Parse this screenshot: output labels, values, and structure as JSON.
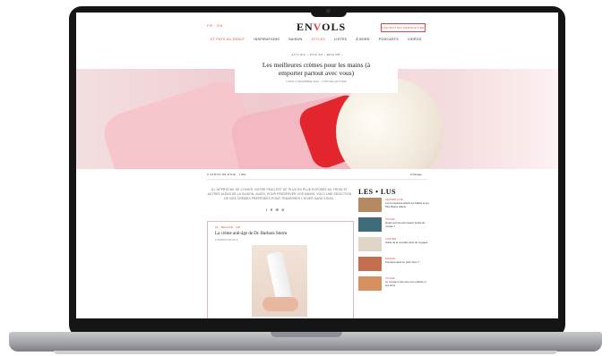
{
  "site": {
    "logo": "ENVOLS",
    "logo_accent_index": 2,
    "languages": "FR · EN",
    "newsletter_label": "INSCRIPTION NEWSLETTER"
  },
  "nav": {
    "items": [
      {
        "label": "ET PAYS AU DEBUT",
        "highlight": true
      },
      {
        "label": "INSPIRATIONS",
        "highlight": false
      },
      {
        "label": "SAISON",
        "highlight": false
      },
      {
        "label": "STYLES",
        "highlight": true
      },
      {
        "label": "LISTES",
        "highlight": false
      },
      {
        "label": "À BORD",
        "highlight": false
      },
      {
        "label": "PODCASTS",
        "highlight": false
      },
      {
        "label": "VIDÉOS",
        "highlight": false
      }
    ]
  },
  "breadcrumb": "ACCUEIL › STYLES › BEAUTÉ ›",
  "article": {
    "title_line1": "Les meilleures crèmes pour les mains (à",
    "title_line2": "emporter partout avec vous)",
    "meta": "LUNDI 2 DÉCEMBRE 2024 · 4 MIN DE LECTURE",
    "author": "À PARTIR DE ETHE · LIRE",
    "comments": "0 Partage",
    "intro": "À L'APPROCHE DE L'HIVER, NOTRE PEAU EST DE PLUS EN PLUS EXPOSÉE AU FROID ET AUTRES ALÉAS DE LA SAISON. AUSSI, POUR PRÉSERVER VOS MAINS, VOICI UNE SÉLECTION DE NOS CRÈMES PRÉFÉRÉES POUR TRAVERSER L'HIVER SANS SOUCI.",
    "share": "f ✕ ✉ ⊘"
  },
  "product_card": {
    "tag": "01 · BEAUTÉ · DR",
    "title": "La crème anti-âge de Dr. Barbara Sturm",
    "subtitle": "À PARTIR DE 60 €"
  },
  "sidebar": {
    "heading": "LES • LUS",
    "items": [
      {
        "category": "SÉJOURS & CIE",
        "text": "Les Complexes Hôtels les Tables et les Plus Beaux Hôtels",
        "thumb": "#b58a62"
      },
      {
        "category": "VOYAGE",
        "text": "Quels sont les plus beaux hôtels du monde ?",
        "thumb": "#3f6b7a"
      },
      {
        "category": "CULTURE",
        "text": "Sortie de la nouvelle série de voyages",
        "thumb": "#dfd5c8"
      },
      {
        "category": "ÉVASION",
        "text": "Pourquoi partir en plein hiver ?",
        "thumb": "#c46e50"
      },
      {
        "category": "VOYAGE",
        "text": "Le monde à vélo avec ses enfants et ses amis",
        "thumb": "#d79060"
      }
    ]
  },
  "colors": {
    "accent": "#e0443a",
    "frame": "#151515"
  }
}
